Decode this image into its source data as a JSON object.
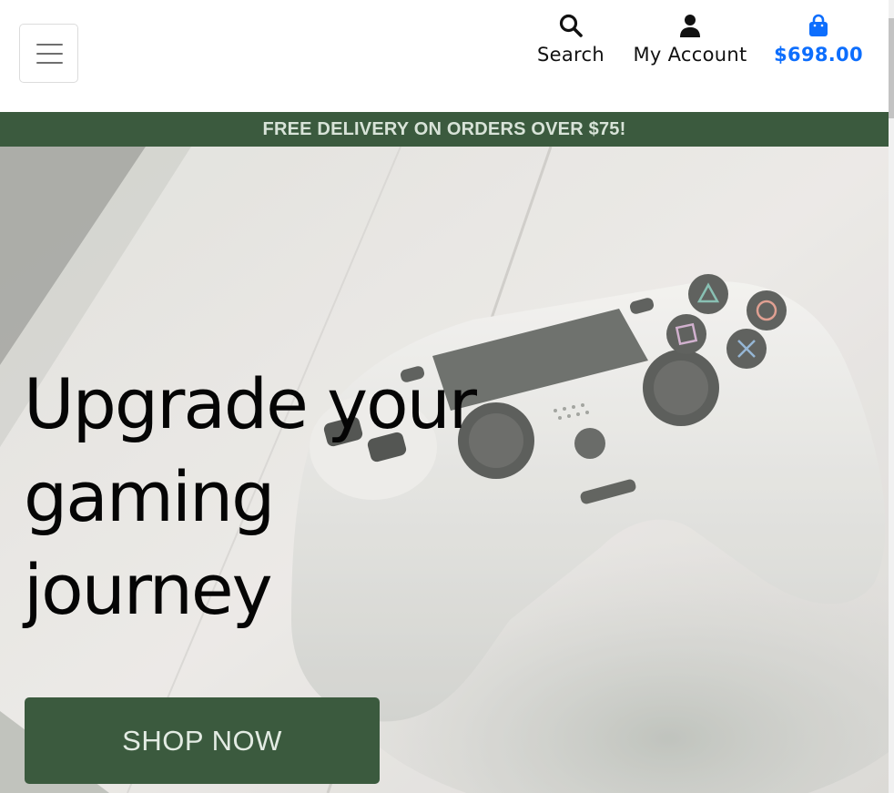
{
  "header": {
    "menu_icon": "hamburger-menu-icon",
    "nav": {
      "search": {
        "label": "Search",
        "icon": "search-icon"
      },
      "account": {
        "label": "My Account",
        "icon": "user-icon"
      },
      "cart": {
        "total": "$698.00",
        "icon": "shopping-bag-icon"
      }
    }
  },
  "banner": {
    "text": "FREE DELIVERY ON ORDERS OVER $75!"
  },
  "hero": {
    "title_lines": [
      "Upgrade your",
      "gaming",
      "journey"
    ],
    "button_label": "SHOP NOW",
    "image": "game-controller-photo"
  },
  "colors": {
    "brand_green": "#3b5a3e",
    "cart_blue": "#0d6efd",
    "text_dark": "#111111",
    "hero_background": "#e6e3e0"
  }
}
